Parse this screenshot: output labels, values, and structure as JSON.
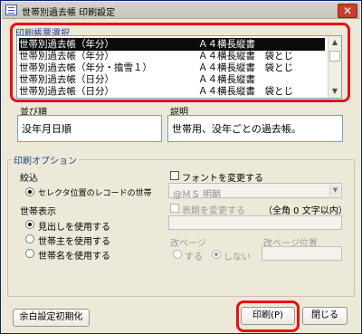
{
  "window": {
    "title": "世帯別過去帳 印刷設定",
    "close_glyph": "✕"
  },
  "form_list": {
    "label": "印刷帳票選択",
    "items": [
      {
        "name": "世帯別過去帳（年分）",
        "desc": "Ａ４横長縦書"
      },
      {
        "name": "世帯別過去帳（年分）",
        "desc": "Ａ４横長縦書　袋とじ"
      },
      {
        "name": "世帯別過去帳（年分・擔雪１）",
        "desc": "Ａ４横長縦書　袋とじ"
      },
      {
        "name": "世帯別過去帳（日分）",
        "desc": "Ａ４横長縦書"
      },
      {
        "name": "世帯別過去帳（日分）",
        "desc": "Ａ４横長縦書　袋とじ"
      }
    ],
    "selected_index": 0,
    "scroll_up": "▲",
    "scroll_down": "▼"
  },
  "order": {
    "label": "並び順",
    "value": "没年月日順"
  },
  "description": {
    "label": "説明",
    "value": "世帯用、没年ごとの過去帳。"
  },
  "options": {
    "label": "印刷オプション",
    "filter": {
      "label": "絞込",
      "option": "セレクタ位置のレコードの世帯"
    },
    "font": {
      "checkbox_label": "フォントを変更する",
      "value": "@ＭＳ 明朝",
      "arrow": "▼"
    },
    "display": {
      "label": "世帯表示",
      "options": [
        "見出しを使用する",
        "世帯主を使用する",
        "世帯名を使用する"
      ],
      "selected_index": 0
    },
    "heading": {
      "checkbox_label": "表題を変更する",
      "limit_text": "（全角 0 文字以内）"
    },
    "page_break": {
      "label": "改ページ",
      "yes": "する",
      "no": "しない"
    },
    "page_break_position": {
      "label": "改ページ位置"
    }
  },
  "buttons": {
    "reset_margins": "余白設定初期化",
    "print": "印刷(P)",
    "close": "閉じる"
  },
  "colors": {
    "highlight": "#e3121a",
    "selection": "#0b0b0b",
    "section_text": "#1f3f8f"
  }
}
